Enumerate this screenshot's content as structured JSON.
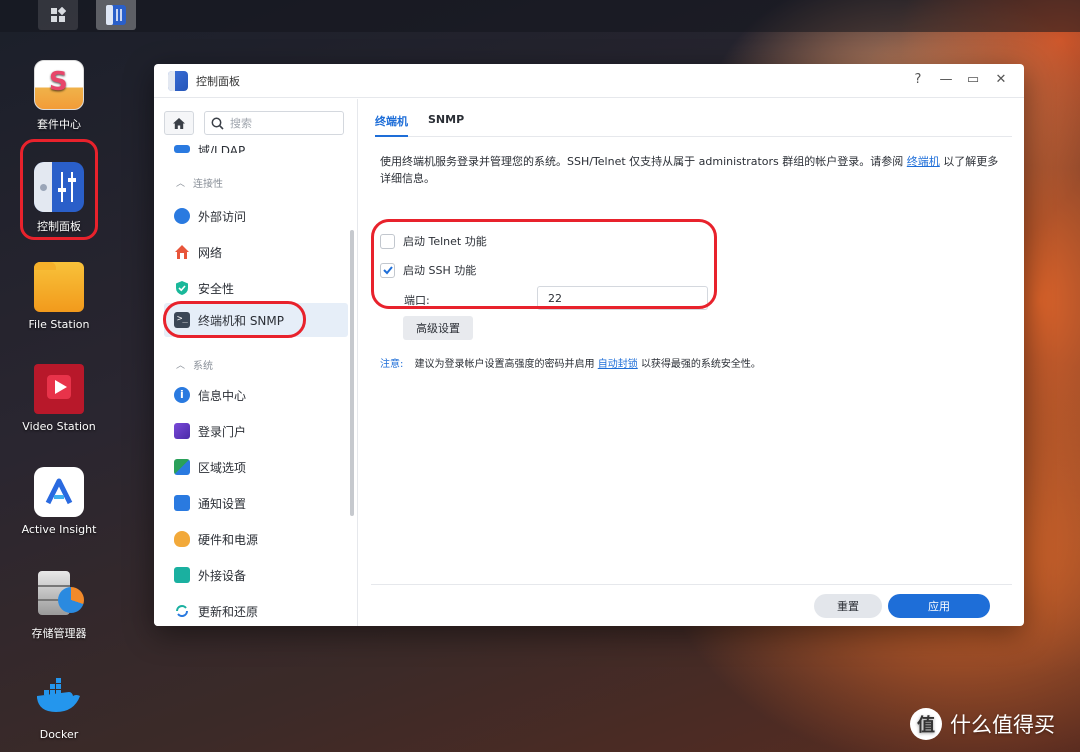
{
  "desktop": {
    "icons": [
      {
        "label": "套件中心"
      },
      {
        "label": "控制面板"
      },
      {
        "label": "File Station"
      },
      {
        "label": "Video Station"
      },
      {
        "label": "Active Insight"
      },
      {
        "label": "存储管理器"
      },
      {
        "label": "Docker"
      }
    ]
  },
  "window": {
    "title": "控制面板",
    "help": "?",
    "minimize": "—",
    "maximize": "▭",
    "close": "✕"
  },
  "sidebar": {
    "search_placeholder": "搜索",
    "partial_item": "域/LDAP",
    "groups": [
      {
        "label": "连接性"
      },
      {
        "label": "系统"
      }
    ],
    "items": [
      {
        "label": "外部访问"
      },
      {
        "label": "网络"
      },
      {
        "label": "安全性"
      },
      {
        "label": "终端机和 SNMP"
      },
      {
        "label": "信息中心"
      },
      {
        "label": "登录门户"
      },
      {
        "label": "区域选项"
      },
      {
        "label": "通知设置"
      },
      {
        "label": "硬件和电源"
      },
      {
        "label": "外接设备"
      },
      {
        "label": "更新和还原"
      }
    ]
  },
  "main": {
    "tabs": [
      {
        "label": "终端机"
      },
      {
        "label": "SNMP"
      }
    ],
    "description_pre": "使用终端机服务登录并管理您的系统。SSH/Telnet 仅支持从属于 administrators 群组的帐户登录。请参阅",
    "description_link": "终端机",
    "description_post": "以了解更多详细信息。",
    "telnet_label": "启动 Telnet 功能",
    "telnet_checked": false,
    "ssh_label": "启动 SSH 功能",
    "ssh_checked": true,
    "port_label": "端口:",
    "port_value": "22",
    "advanced_button": "高级设置",
    "note_label": "注意:",
    "note_pre": "建议为登录帐户设置高强度的密码并启用",
    "note_link": "自动封锁",
    "note_post": "以获得最强的系统安全性。"
  },
  "footer": {
    "reset_label": "重置",
    "apply_label": "应用"
  },
  "watermark": {
    "badge": "值",
    "text": "什么值得买"
  },
  "colors": {
    "accent": "#1e6ed8",
    "highlight": "#e8222c"
  }
}
